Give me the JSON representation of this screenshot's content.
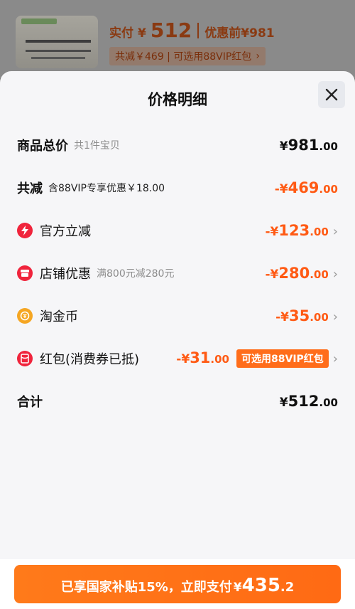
{
  "background": {
    "paid_label": "实付",
    "currency": "¥",
    "paid_amount": "512",
    "before_discount": "优惠前¥981",
    "sub_line": "共减￥469 | 可选用88VIP红包",
    "sub_chevron": "›"
  },
  "sheet": {
    "title": "价格明细",
    "close_icon": "close-icon"
  },
  "rows": {
    "total_goods": {
      "label": "商品总价",
      "sub": "共1件宝贝",
      "yen": "¥",
      "int": "981",
      "dec": ".00"
    },
    "total_reduce": {
      "label": "共减",
      "sub": "含88VIP专享优惠￥18.00",
      "yen": "-¥",
      "int": "469",
      "dec": ".00"
    },
    "official": {
      "label": "官方立减",
      "icon": "lightning-icon",
      "yen": "-¥",
      "int": "123",
      "dec": ".00",
      "chevron": "›"
    },
    "store": {
      "label": "店铺优惠",
      "icon": "store-icon",
      "sub": "满800元减280元",
      "yen": "-¥",
      "int": "280",
      "dec": ".00",
      "chevron": "›"
    },
    "coins": {
      "label": "淘金币",
      "icon": "coin-icon",
      "yen": "-¥",
      "int": "35",
      "dec": ".00",
      "chevron": "›"
    },
    "redpacket": {
      "label": "红包(消费券已抵)",
      "icon": "red-packet-icon",
      "yen": "-¥",
      "int": "31",
      "dec": ".00",
      "tag": "可选用88VIP红包",
      "chevron": "›"
    },
    "sum": {
      "label": "合计",
      "yen": "¥",
      "int": "512",
      "dec": ".00"
    }
  },
  "footer": {
    "button_text": "已享国家补贴15%，立即支付",
    "yen": "¥",
    "int": "435",
    "dec": ".2"
  },
  "colors": {
    "accent": "#ff5a14",
    "button": "#ff6a14",
    "icon_red": "#f0243c",
    "icon_gold": "#f5a623"
  }
}
